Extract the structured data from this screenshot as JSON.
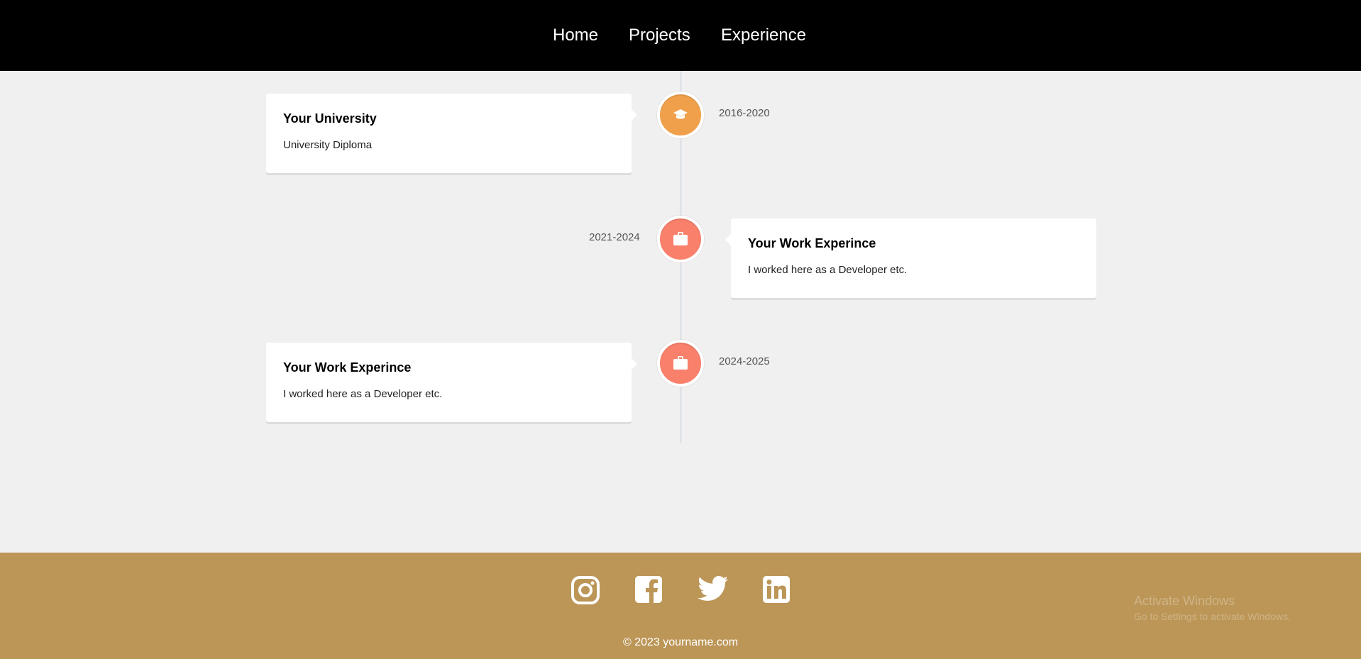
{
  "nav": {
    "links": [
      "Home",
      "Projects",
      "Experience"
    ]
  },
  "timeline": {
    "items": [
      {
        "title": "Your University",
        "description": "University Diploma",
        "date": "2016-2020",
        "side": "left",
        "icon": "graduation-cap-icon",
        "icon_color": "#f0a04b"
      },
      {
        "title": "Your Work Experince",
        "description": "I worked here as a Developer etc.",
        "date": "2021-2024",
        "side": "right",
        "icon": "briefcase-icon",
        "icon_color": "#f9806b"
      },
      {
        "title": "Your Work Experince",
        "description": "I worked here as a Developer etc.",
        "date": "2024-2025",
        "side": "left",
        "icon": "briefcase-icon",
        "icon_color": "#f9806b"
      }
    ]
  },
  "footer": {
    "background": "#bc9657",
    "social": [
      "instagram-icon",
      "facebook-icon",
      "twitter-icon",
      "linkedin-icon"
    ],
    "copyright": "© 2023 yourname.com"
  },
  "watermark": {
    "title": "Activate Windows",
    "subtitle": "Go to Settings to activate Windows."
  },
  "colors": {
    "nav_bg": "#000000",
    "page_bg": "#f0f0f0",
    "footer_bg": "#bc9657"
  }
}
